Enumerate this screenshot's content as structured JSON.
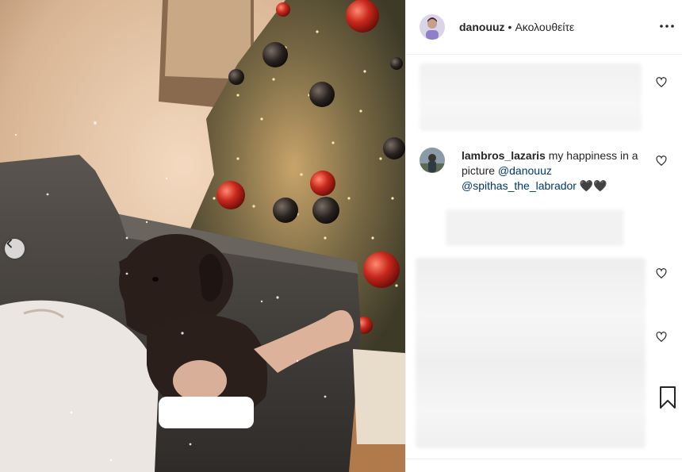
{
  "post": {
    "username": "danouuz",
    "separator": "•",
    "follow_status": "Ακολουθείτε"
  },
  "comment": {
    "username": "lambros_lazaris",
    "text": "my happiness in a picture",
    "mention_1": "@danouuz",
    "mention_2": "@spithas_the_labrador",
    "emoji": "🖤🖤"
  },
  "icons": {
    "more": "more-horizontal-icon",
    "like": "heart-outline-icon",
    "save": "bookmark-icon",
    "prev": "chevron-left-icon"
  },
  "colors": {
    "text": "#262626",
    "mention": "#00376b",
    "divider": "#efefef"
  }
}
